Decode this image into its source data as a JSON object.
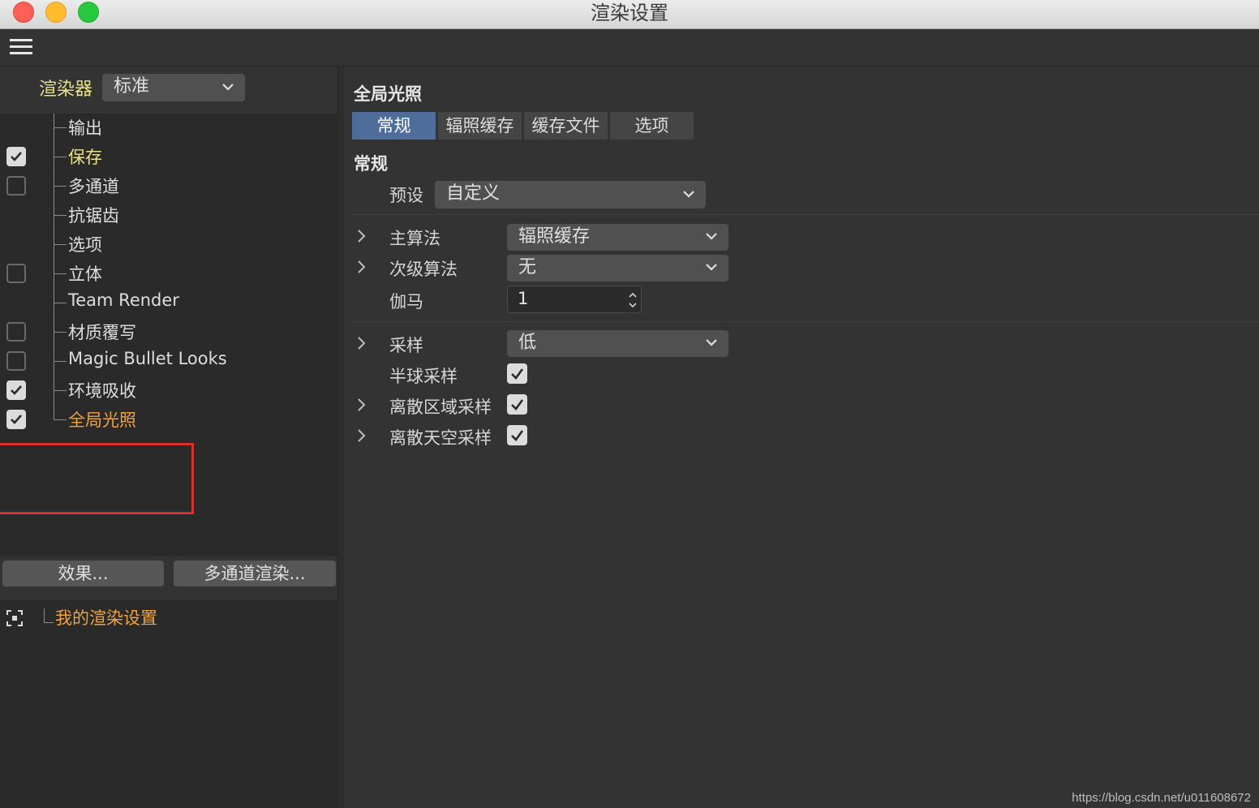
{
  "window": {
    "title": "渲染设置"
  },
  "sidebar": {
    "renderer_label": "渲染器",
    "renderer_value": "标准",
    "items": [
      {
        "label": "输出",
        "checkbox": null,
        "style": "normal"
      },
      {
        "label": "保存",
        "checkbox": true,
        "style": "yellow"
      },
      {
        "label": "多通道",
        "checkbox": false,
        "style": "normal"
      },
      {
        "label": "抗锯齿",
        "checkbox": null,
        "style": "normal"
      },
      {
        "label": "选项",
        "checkbox": null,
        "style": "normal"
      },
      {
        "label": "立体",
        "checkbox": false,
        "style": "normal"
      },
      {
        "label": "Team Render",
        "checkbox": null,
        "style": "normal"
      },
      {
        "label": "材质覆写",
        "checkbox": false,
        "style": "normal"
      },
      {
        "label": "Magic Bullet Looks",
        "checkbox": false,
        "style": "normal"
      },
      {
        "label": "环境吸收",
        "checkbox": true,
        "style": "normal"
      },
      {
        "label": "全局光照",
        "checkbox": true,
        "style": "orange"
      }
    ],
    "effects_button": "效果...",
    "multipass_button": "多通道渲染...",
    "preset_name": "我的渲染设置"
  },
  "main": {
    "section_title": "全局光照",
    "tabs": [
      {
        "label": "常规",
        "active": true
      },
      {
        "label": "辐照缓存",
        "active": false
      },
      {
        "label": "缓存文件",
        "active": false
      },
      {
        "label": "选项",
        "active": false
      }
    ],
    "group_title": "常规",
    "preset_label": "预设",
    "preset_value": "自定义",
    "primary_method_label": "主算法",
    "primary_method_value": "辐照缓存",
    "secondary_method_label": "次级算法",
    "secondary_method_value": "无",
    "gamma_label": "伽马",
    "gamma_value": "1",
    "sampling_label": "采样",
    "sampling_value": "低",
    "hemisphere_label": "半球采样",
    "hemisphere_checked": true,
    "discrete_area_label": "离散区域采样",
    "discrete_area_checked": true,
    "discrete_sky_label": "离散天空采样",
    "discrete_sky_checked": true
  },
  "footer": {
    "watermark": "https://blog.csdn.net/u011608672"
  },
  "colors": {
    "accent_tab": "#4f6d9a",
    "yellow_label": "#e8e18a",
    "orange_label": "#f0a23c",
    "highlight_box": "#d9302c"
  }
}
